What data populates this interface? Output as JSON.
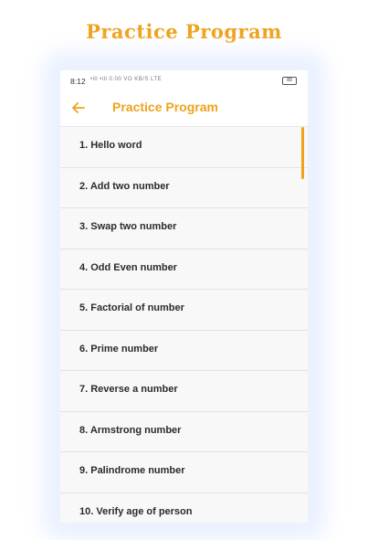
{
  "promo": {
    "title": "Practice Program"
  },
  "status_bar": {
    "time": "8:12",
    "icons_text": "•ill •ill 0.00 VO KB/S LTE",
    "battery": "89"
  },
  "app_bar": {
    "title": "Practice Program",
    "back_icon": "arrow-left-icon"
  },
  "programs": [
    "1. Hello word",
    "2. Add two number",
    "3. Swap two number",
    "4. Odd Even number",
    "5. Factorial of number",
    "6. Prime number",
    "7. Reverse a number",
    "8. Armstrong number",
    "9. Palindrome number",
    "10. Verify age of person"
  ],
  "colors": {
    "accent": "#f0a21e"
  }
}
